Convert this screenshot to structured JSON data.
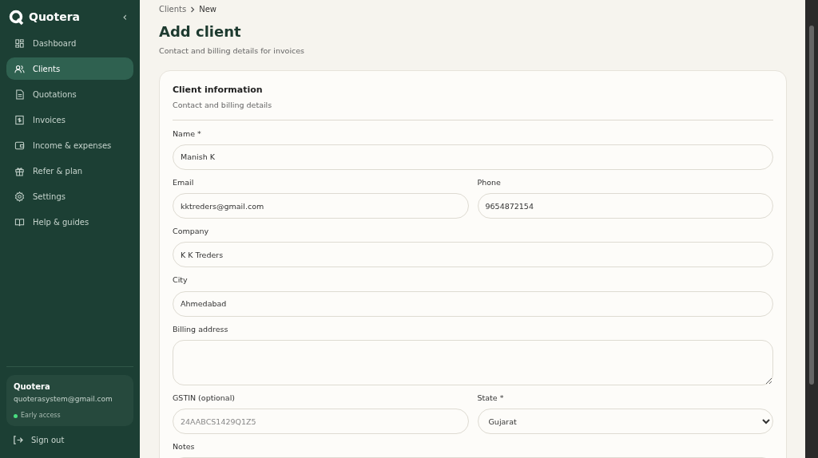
{
  "sidebar": {
    "brand": "Quotera",
    "collapse": "‹",
    "items": [
      {
        "label": "Dashboard",
        "selected": false
      },
      {
        "label": "Clients",
        "selected": true
      },
      {
        "label": "Quotations",
        "selected": false
      },
      {
        "label": "Invoices",
        "selected": false
      },
      {
        "label": "Income & expenses",
        "selected": false
      },
      {
        "label": "Refer & plan",
        "selected": false
      },
      {
        "label": "Settings",
        "selected": false
      },
      {
        "label": "Help & guides",
        "selected": false
      }
    ],
    "account": {
      "name": "Quotera",
      "email": "quoterasystem@gmail.com",
      "badge": "Early access"
    },
    "sign_out": "Sign out"
  },
  "breadcrumb": [
    "Clients",
    "New"
  ],
  "title": "Add client",
  "subtitle": "Contact and billing details for invoices",
  "card": {
    "title": "Client information",
    "subtitle": "Contact and billing details",
    "rows": [
      [
        {
          "label": "Name *",
          "kind": "text",
          "value": "Manish K"
        }
      ],
      [
        {
          "label": "Email",
          "kind": "text",
          "value": "kktreders@gmail.com"
        },
        {
          "label": "Phone",
          "kind": "text",
          "value": "9654872154"
        }
      ],
      [
        {
          "label": "Company",
          "kind": "text",
          "value": "K K Treders"
        }
      ],
      [
        {
          "label": "City",
          "kind": "text",
          "value": "Ahmedabad"
        }
      ],
      [
        {
          "label": "Billing address",
          "kind": "textarea"
        }
      ],
      [
        {
          "label": "GSTIN (optional)",
          "kind": "text",
          "placeholder": "24AABCS1429Q1Z5"
        },
        {
          "label": "State *",
          "kind": "select",
          "value": "Gujarat"
        }
      ],
      [
        {
          "label": "Notes",
          "kind": "textarea"
        }
      ]
    ]
  }
}
